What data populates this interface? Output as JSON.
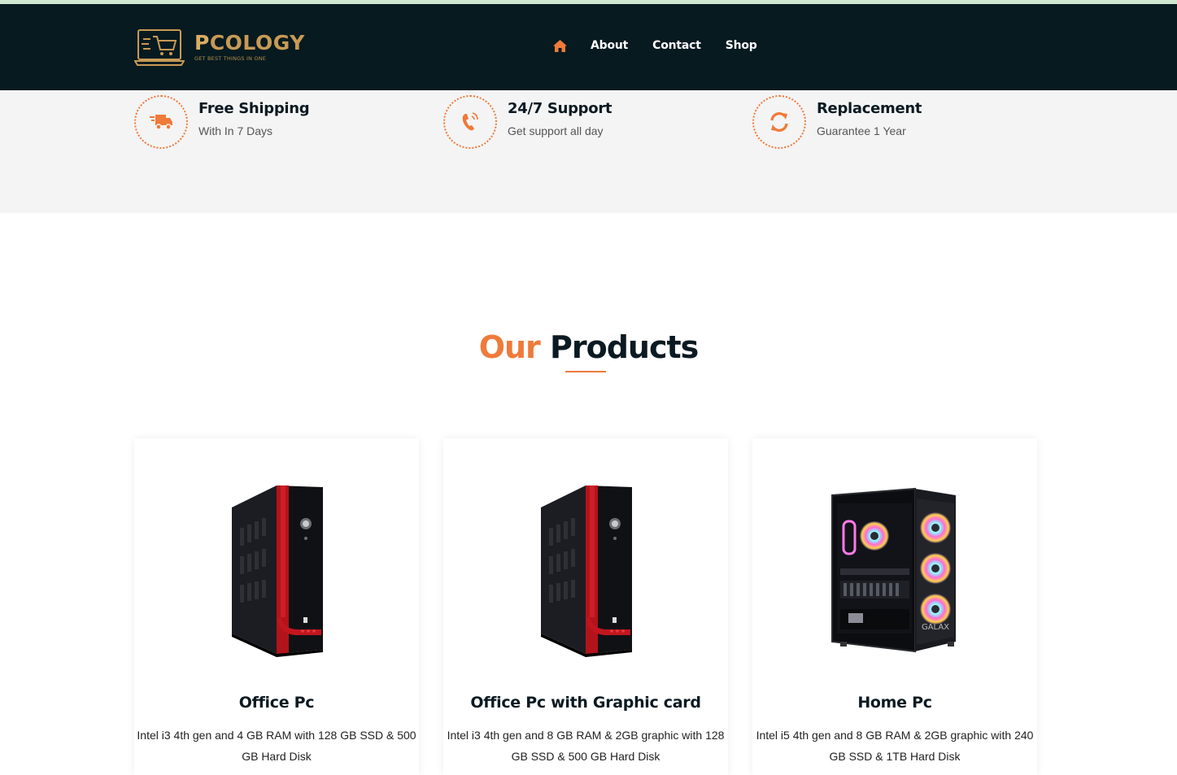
{
  "brand": {
    "name_first": "P",
    "name_rest": "COLOGY",
    "tagline": "GET BEST THINGS IN ONE"
  },
  "nav": {
    "home_icon": "home-icon",
    "links": [
      "About",
      "Contact",
      "Shop"
    ]
  },
  "features": [
    {
      "icon": "truck-icon",
      "title": "Free Shipping",
      "subtitle": "With In 7 Days"
    },
    {
      "icon": "phone-icon",
      "title": "24/7 Support",
      "subtitle": "Get support all day"
    },
    {
      "icon": "refresh-icon",
      "title": "Replacement",
      "subtitle": "Guarantee 1 Year"
    }
  ],
  "section": {
    "title_accent": "Our",
    "title_main": "Products"
  },
  "products": [
    {
      "title": "Office Pc",
      "description": "Intel i3 4th gen and 4 GB RAM with 128 GB SSD & 500 GB Hard Disk",
      "image": "black-red-tower-pc"
    },
    {
      "title": "Office Pc with Graphic card",
      "description": "Intel i3 4th gen and 8 GB RAM & 2GB graphic with 128 GB SSD & 500 GB Hard Disk",
      "image": "black-red-tower-pc"
    },
    {
      "title": "Home Pc",
      "description": "Intel i5 4th gen and 8 GB RAM & 2GB graphic with 240 GB SSD & 1TB Hard Disk",
      "image": "rgb-gaming-pc",
      "image_label": "GALAX"
    }
  ],
  "colors": {
    "accent": "#ef7a3a",
    "navbar": "#061a20",
    "gold": "#c79a55",
    "feature_bg": "#f4f4f4"
  }
}
